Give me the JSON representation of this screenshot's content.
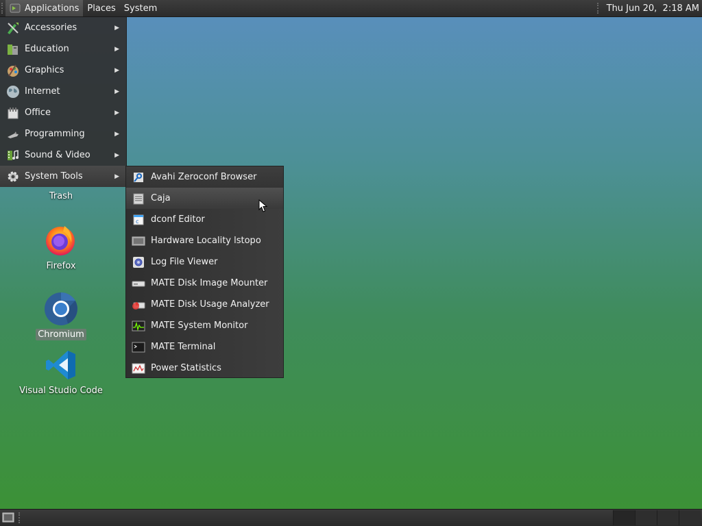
{
  "top_panel": {
    "menus": [
      {
        "label": "Applications"
      },
      {
        "label": "Places"
      },
      {
        "label": "System"
      }
    ],
    "clock": "Thu Jun 20,  2:18 AM"
  },
  "apps_menu": {
    "items": [
      {
        "label": "Accessories",
        "icon": "accessories-icon"
      },
      {
        "label": "Education",
        "icon": "education-icon"
      },
      {
        "label": "Graphics",
        "icon": "graphics-icon"
      },
      {
        "label": "Internet",
        "icon": "internet-icon"
      },
      {
        "label": "Office",
        "icon": "office-icon"
      },
      {
        "label": "Programming",
        "icon": "programming-icon"
      },
      {
        "label": "Sound & Video",
        "icon": "sound-video-icon"
      },
      {
        "label": "System Tools",
        "icon": "system-tools-icon",
        "active": true
      }
    ]
  },
  "system_tools_menu": {
    "items": [
      {
        "label": "Avahi Zeroconf Browser",
        "icon": "avahi-icon"
      },
      {
        "label": "Caja",
        "icon": "caja-icon",
        "hovered": true
      },
      {
        "label": "dconf Editor",
        "icon": "dconf-icon"
      },
      {
        "label": "Hardware Locality lstopo",
        "icon": "lstopo-icon"
      },
      {
        "label": "Log File Viewer",
        "icon": "log-viewer-icon"
      },
      {
        "label": "MATE Disk Image Mounter",
        "icon": "disk-mounter-icon"
      },
      {
        "label": "MATE Disk Usage Analyzer",
        "icon": "disk-usage-icon"
      },
      {
        "label": "MATE System Monitor",
        "icon": "system-monitor-icon"
      },
      {
        "label": "MATE Terminal",
        "icon": "terminal-icon"
      },
      {
        "label": "Power Statistics",
        "icon": "power-stats-icon"
      }
    ]
  },
  "desktop": {
    "icons": [
      {
        "label": "Trash",
        "icon": "trash-icon"
      },
      {
        "label": "Firefox",
        "icon": "firefox-icon"
      },
      {
        "label": "Chromium",
        "icon": "chromium-icon",
        "selected": true
      },
      {
        "label": "Visual Studio Code",
        "icon": "vscode-icon"
      }
    ]
  }
}
